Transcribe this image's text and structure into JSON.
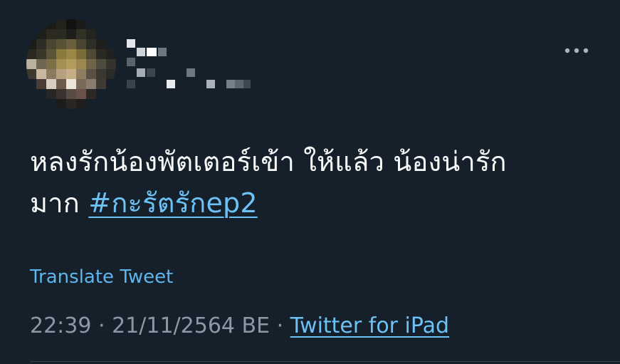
{
  "tweet": {
    "text_line1": "หลงรักน้องพัตเตอร์เข้า ให้แล้ว น้องน่ารัก",
    "text_line2_prefix": "มาก ",
    "hashtag": "#กะรัตรักep2",
    "translate_label": "Translate Tweet",
    "time": "22:39",
    "separator1": " · ",
    "date": "21/11/2564 BE",
    "separator2": " · ",
    "source": "Twitter for iPad"
  },
  "icons": {
    "more": "more-horizontal-icon",
    "avatar": "pixelated-avatar"
  },
  "colors": {
    "background": "#15202b",
    "text": "#f7f9f9",
    "link": "#6cc1f5",
    "muted": "#8b98a5"
  }
}
